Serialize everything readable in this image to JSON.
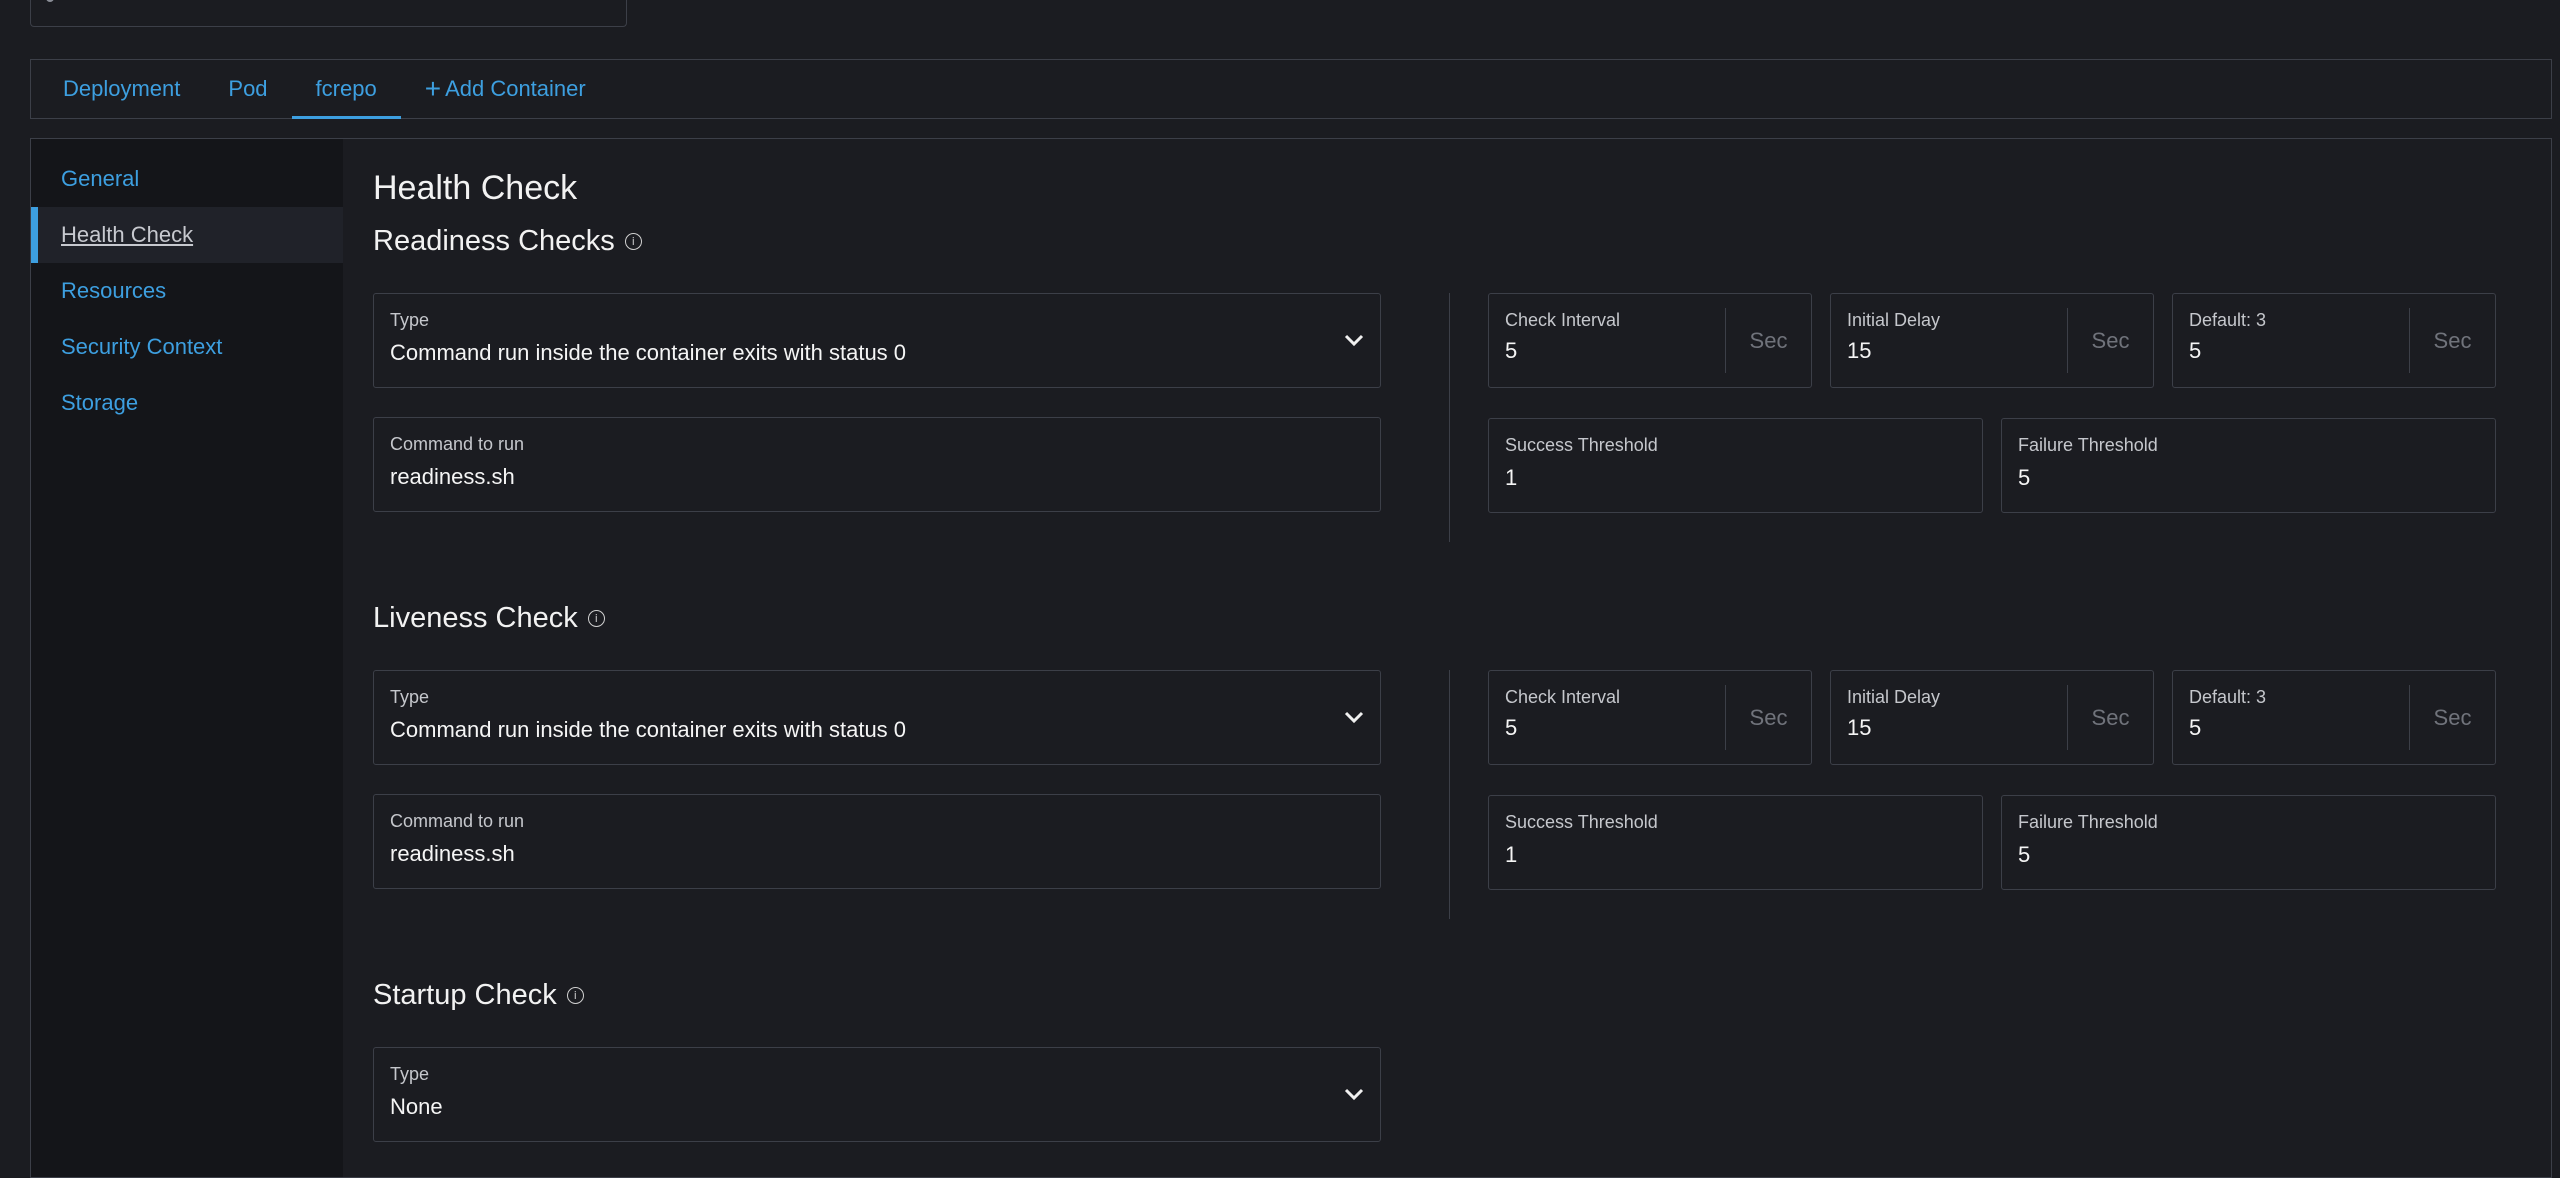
{
  "tabs": [
    {
      "label": "Deployment"
    },
    {
      "label": "Pod"
    },
    {
      "label": "fcrepo"
    },
    {
      "label": "Add Container"
    }
  ],
  "sidebar": {
    "items": [
      {
        "label": "General"
      },
      {
        "label": "Health Check"
      },
      {
        "label": "Resources"
      },
      {
        "label": "Security Context"
      },
      {
        "label": "Storage"
      }
    ]
  },
  "page_title": "Health Check",
  "readiness": {
    "title": "Readiness Checks",
    "type_label": "Type",
    "type_value": "Command run inside the container exits with status 0",
    "command_label": "Command to run",
    "command_value": "readiness.sh",
    "check_interval_label": "Check Interval",
    "check_interval_value": "5",
    "initial_delay_label": "Initial Delay",
    "initial_delay_value": "15",
    "default_label": "Default: 3",
    "default_value": "5",
    "unit": "Sec",
    "success_label": "Success Threshold",
    "success_value": "1",
    "failure_label": "Failure Threshold",
    "failure_value": "5"
  },
  "liveness": {
    "title": "Liveness Check",
    "type_label": "Type",
    "type_value": "Command run inside the container exits with status 0",
    "command_label": "Command to run",
    "command_value": "readiness.sh",
    "check_interval_label": "Check Interval",
    "check_interval_value": "5",
    "initial_delay_label": "Initial Delay",
    "initial_delay_value": "15",
    "default_label": "Default: 3",
    "default_value": "5",
    "unit": "Sec",
    "success_label": "Success Threshold",
    "success_value": "1",
    "failure_label": "Failure Threshold",
    "failure_value": "5"
  },
  "startup": {
    "title": "Startup Check",
    "type_label": "Type",
    "type_value": "None"
  },
  "colors": {
    "accent": "#3d9fe0",
    "background": "#1b1c21",
    "sidebar": "#141519",
    "border": "#3c3f48"
  }
}
